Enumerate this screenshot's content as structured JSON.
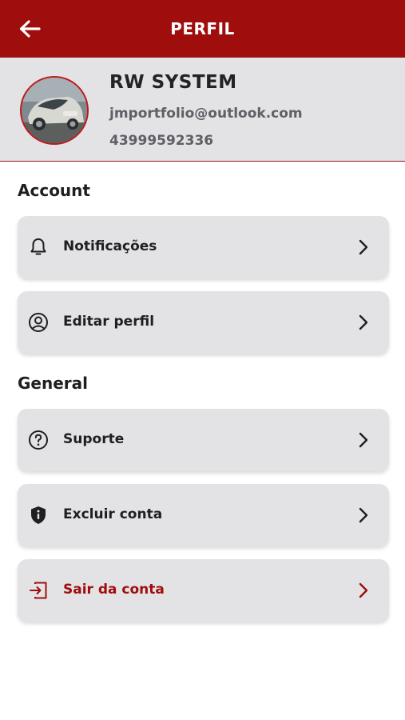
{
  "header": {
    "title": "PERFIL",
    "back_icon": "arrow-left-icon",
    "background": "#a00d0d"
  },
  "profile": {
    "name": "RW SYSTEM",
    "email": "jmportfolio@outlook.com",
    "phone": "43999592336",
    "avatar": "car-photo"
  },
  "sections": {
    "account": {
      "title": "Account",
      "items": [
        {
          "label": "Notificações",
          "icon": "bell-icon"
        },
        {
          "label": "Editar perfil",
          "icon": "user-circle-icon"
        }
      ]
    },
    "general": {
      "title": "General",
      "items": [
        {
          "label": "Suporte",
          "icon": "help-circle-icon"
        },
        {
          "label": "Excluir conta",
          "icon": "shield-info-icon"
        },
        {
          "label": "Sair da conta",
          "icon": "logout-icon",
          "color": "#a00d0d"
        }
      ]
    }
  },
  "colors": {
    "accent": "#a00d0d",
    "card": "#e3e3e6",
    "text": "#1e1f22"
  }
}
